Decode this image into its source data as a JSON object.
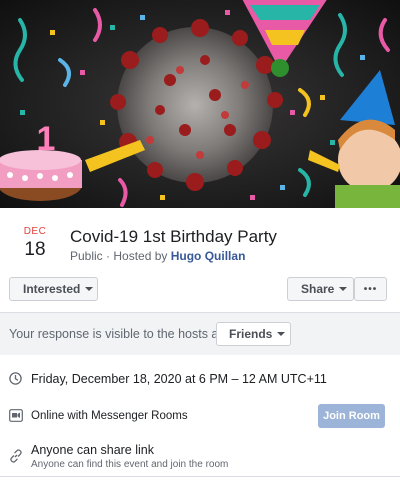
{
  "event": {
    "month": "DEC",
    "day": "18",
    "title": "Covid-19 1st Birthday Party",
    "privacy": "Public",
    "hosted_by_prefix": "· Hosted by",
    "host": "Hugo Quillan"
  },
  "actions": {
    "interested_label": "Interested",
    "share_label": "Share",
    "more_label": "•••"
  },
  "response": {
    "text": "Your response is visible to the hosts and",
    "audience_label": "Friends"
  },
  "details": {
    "time": "Friday, December 18, 2020 at 6 PM – 12 AM UTC+11",
    "location": "Online with Messenger Rooms",
    "join_label": "Join Room",
    "share_title": "Anyone can share link",
    "share_sub": "Anyone can find this event and join the room"
  },
  "cover": {
    "cake_number": "1",
    "colors": {
      "accent": "#385898",
      "date_red": "#e4413b",
      "join_disabled": "#9cb4d8"
    }
  }
}
